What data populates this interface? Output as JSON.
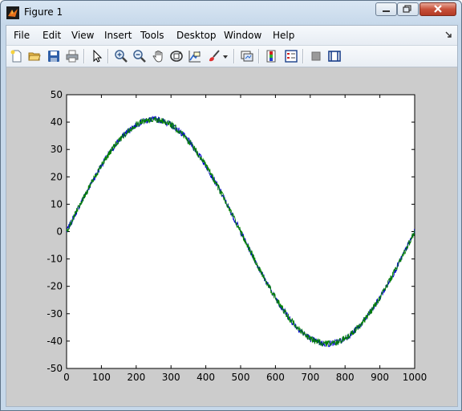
{
  "window": {
    "title": "Figure 1"
  },
  "menu": [
    "File",
    "Edit",
    "View",
    "Insert",
    "Tools",
    "Desktop",
    "Window",
    "Help"
  ],
  "toolbar": {
    "icons": [
      "new-figure-icon",
      "open-file-icon",
      "save-icon",
      "print-icon",
      "pointer-icon",
      "zoom-in-icon",
      "zoom-out-icon",
      "pan-hand-icon",
      "rotate-3d-icon",
      "data-cursor-icon",
      "brush-icon",
      "brush-dropdown-icon",
      "link-plot-icon",
      "insert-colorbar-icon",
      "insert-legend-icon",
      "hide-plot-tools-icon",
      "show-plot-tools-icon"
    ]
  },
  "colors": {
    "figure_bg": "#cccccc",
    "series_blue": "#0000cc",
    "series_green": "#008000"
  },
  "chart_data": {
    "type": "line",
    "title": "",
    "xlabel": "",
    "ylabel": "",
    "xlim": [
      0,
      1000
    ],
    "ylim": [
      -50,
      50
    ],
    "xticks": [
      "0",
      "100",
      "200",
      "300",
      "400",
      "500",
      "600",
      "700",
      "800",
      "900",
      "1000"
    ],
    "yticks": [
      "50",
      "40",
      "30",
      "20",
      "10",
      "0",
      "-10",
      "-20",
      "-30",
      "-40",
      "-50"
    ],
    "grid": false,
    "legend": "none",
    "series": [
      {
        "color": "#0000cc",
        "function": "41*sin(2*pi*x/1000) + noise",
        "amplitude": 41,
        "period": 1000,
        "noise_amplitude": 1.2
      },
      {
        "color": "#008000",
        "function": "41*sin(2*pi*x/1000) + noise",
        "amplitude": 41,
        "period": 1000,
        "noise_amplitude": 1.2
      }
    ]
  }
}
